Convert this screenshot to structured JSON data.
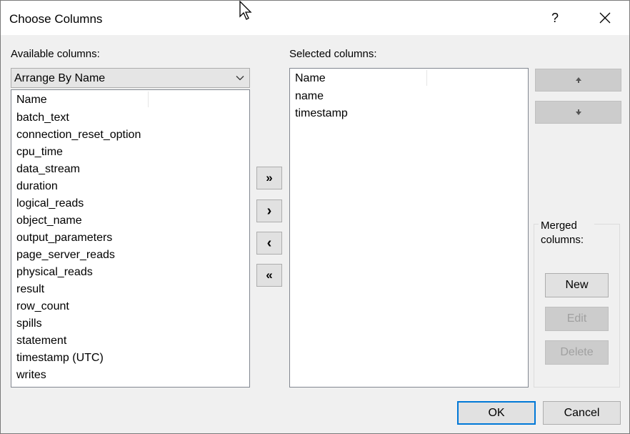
{
  "window": {
    "title": "Choose Columns",
    "help_label": "?",
    "close_icon": "close-icon"
  },
  "available": {
    "label": "Available columns:",
    "arrange": {
      "selected": "Arrange By Name"
    },
    "header": "Name",
    "items": [
      "batch_text",
      "connection_reset_option",
      "cpu_time",
      "data_stream",
      "duration",
      "logical_reads",
      "object_name",
      "output_parameters",
      "page_server_reads",
      "physical_reads",
      "result",
      "row_count",
      "spills",
      "statement",
      "timestamp (UTC)",
      "writes"
    ]
  },
  "movers": {
    "add_all": "»",
    "add": "›",
    "remove": "‹",
    "remove_all": "«"
  },
  "selected": {
    "label": "Selected columns:",
    "header": "Name",
    "items": [
      "name",
      "timestamp"
    ]
  },
  "order": {
    "up_icon": "arrow-up-icon",
    "down_icon": "arrow-down-icon"
  },
  "merged": {
    "label": "Merged columns:",
    "new_label": "New",
    "edit_label": "Edit",
    "delete_label": "Delete"
  },
  "footer": {
    "ok_label": "OK",
    "cancel_label": "Cancel"
  },
  "colors": {
    "dialog_bg": "#f0f0f0",
    "accent": "#0078d7",
    "disabled_text": "#a0a0a0"
  }
}
